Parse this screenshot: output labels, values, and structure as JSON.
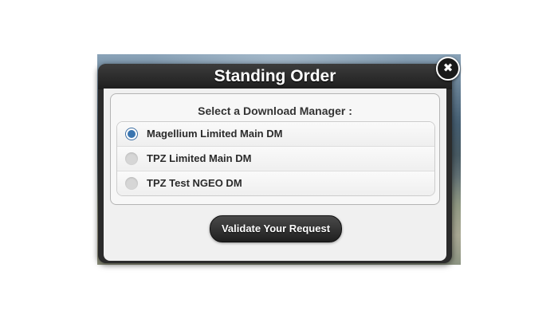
{
  "dialog": {
    "title": "Standing Order",
    "close_icon": "close-icon",
    "prompt": "Select a Download Manager :",
    "options": [
      {
        "label": "Magellium Limited Main DM",
        "selected": true
      },
      {
        "label": "TPZ Limited Main DM",
        "selected": false
      },
      {
        "label": "TPZ Test NGEO DM",
        "selected": false
      }
    ],
    "submit_label": "Validate Your Request"
  },
  "colors": {
    "accent": "#3a75b0",
    "header_bg": "#2b2b2b",
    "body_bg": "#f0f0f0"
  }
}
